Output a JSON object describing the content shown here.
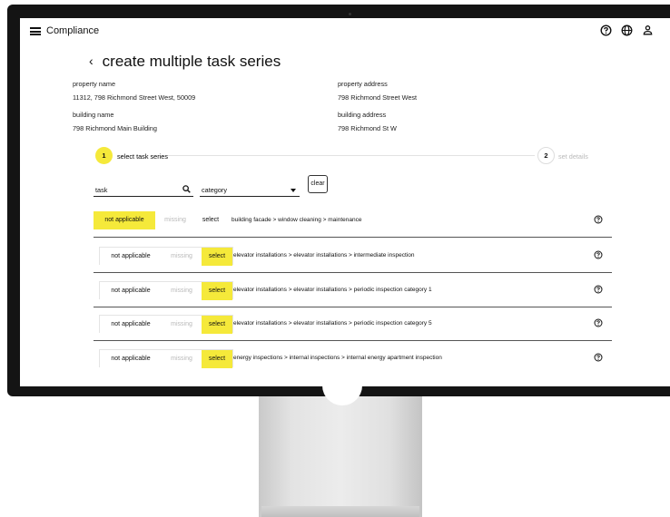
{
  "app": {
    "title": "Compliance"
  },
  "icons": {
    "menu": "hamburger-icon",
    "help": "help-circle-icon",
    "language": "globe-icon",
    "user": "user-icon",
    "search": "search-icon",
    "dropdown": "caret-down-icon",
    "back": "chevron-left-icon"
  },
  "colors": {
    "accent": "#f5e93a",
    "muted": "#b9b9b9"
  },
  "page": {
    "back_glyph": "‹",
    "title": "create multiple task series"
  },
  "property": {
    "name_label": "property name",
    "name_value": "11312, 798 Richmond Street West, 50009",
    "address_label": "property address",
    "address_value": "798 Richmond Street West",
    "building_name_label": "building name",
    "building_name_value": "798 Richmond Main Building",
    "building_address_label": "building address",
    "building_address_value": "798 Richmond St W"
  },
  "stepper": {
    "step1_number": "1",
    "step1_label": "select task series",
    "step2_number": "2",
    "step2_label": "set details"
  },
  "filters": {
    "task_placeholder": "task",
    "category_placeholder": "category",
    "clear_label": "clear"
  },
  "rows": [
    {
      "na": "not applicable",
      "missing": "missing",
      "select": "select",
      "selected": "not applicable",
      "path": "building facade > window cleaning > maintenance"
    },
    {
      "na": "not applicable",
      "missing": "missing",
      "select": "select",
      "selected": "select",
      "path": "elevator installations > elevator installations > intermediate inspection"
    },
    {
      "na": "not applicable",
      "missing": "missing",
      "select": "select",
      "selected": "select",
      "path": "elevator installations > elevator installations > periodic inspection category 1"
    },
    {
      "na": "not applicable",
      "missing": "missing",
      "select": "select",
      "selected": "select",
      "path": "elevator installations > elevator installations > periodic inspection category 5"
    },
    {
      "na": "not applicable",
      "missing": "missing",
      "select": "select",
      "selected": "select",
      "path": "energy inspections > internal inspections > internal energy apartment inspection"
    }
  ]
}
